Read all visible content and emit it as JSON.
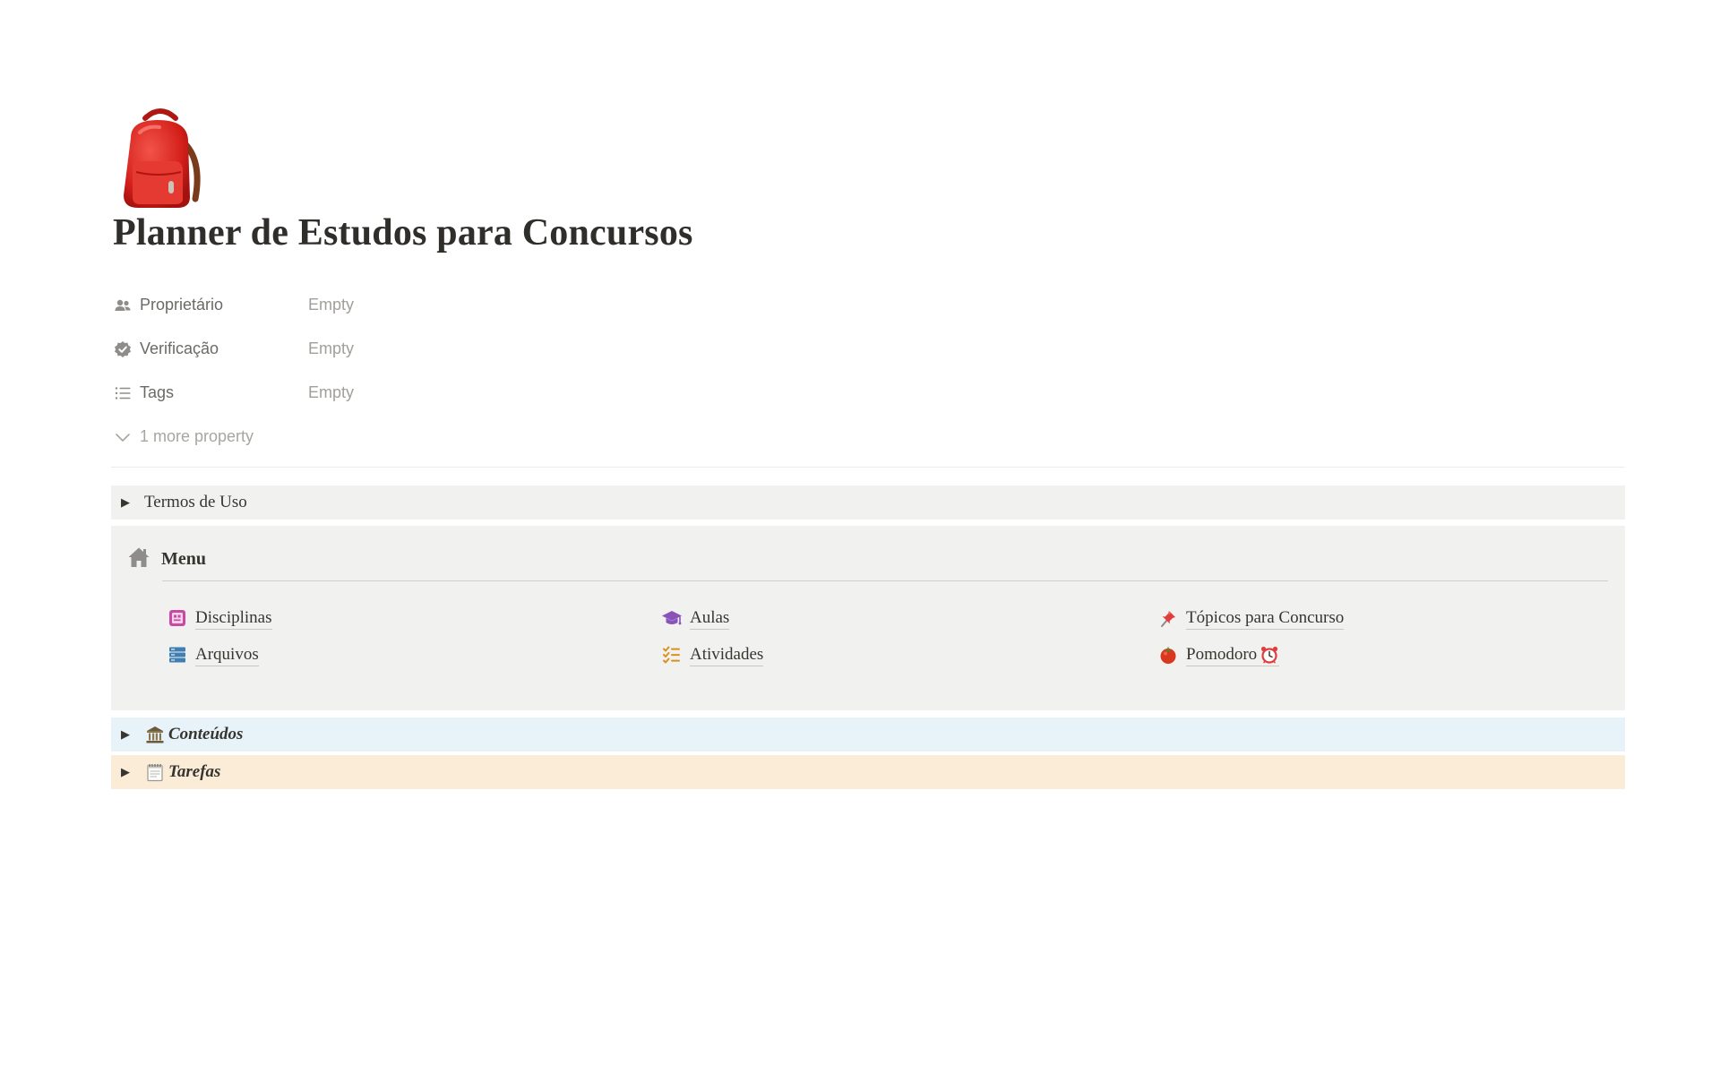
{
  "page": {
    "icon": "backpack-icon",
    "title": "Planner de Estudos para Concursos"
  },
  "properties": [
    {
      "name": "Proprietário",
      "value": "Empty",
      "icon": "people-icon"
    },
    {
      "name": "Verificação",
      "value": "Empty",
      "icon": "verified-badge-icon"
    },
    {
      "name": "Tags",
      "value": "Empty",
      "icon": "list-icon"
    }
  ],
  "more_properties": {
    "label": "1 more property",
    "icon": "chevron-down-icon"
  },
  "toggles": {
    "termos": {
      "label": "Termos de Uso"
    },
    "conteudos": {
      "label": "Conteúdos",
      "emoji": "classical-building-icon"
    },
    "tarefas": {
      "label": "Tarefas",
      "emoji": "spiral-notepad-icon"
    }
  },
  "menu": {
    "title": "Menu",
    "icon": "home-icon",
    "links": [
      {
        "label": "Disciplinas",
        "icon": "notebook-icon",
        "color": "#c84aa3"
      },
      {
        "label": "Aulas",
        "icon": "graduation-cap-icon",
        "color": "#8a53b8"
      },
      {
        "label": "Tópicos para Concurso",
        "icon": "pushpin-icon",
        "color": "#e03e3e"
      },
      {
        "label": "Arquivos",
        "icon": "database-icon",
        "color": "#3f7fb3"
      },
      {
        "label": "Atividades",
        "icon": "checklist-icon",
        "color": "#d9901f"
      },
      {
        "label": "Pomodoro",
        "icon": "tomato-icon",
        "color": "#d9381e",
        "suffix_icon": "alarm-clock-icon"
      }
    ]
  },
  "colors": {
    "text": "#37352f",
    "muted": "#a19f9a",
    "gray_block": "#f1f1ef",
    "blue_block": "#e7f3f8",
    "orange_block": "#fbecd7"
  }
}
